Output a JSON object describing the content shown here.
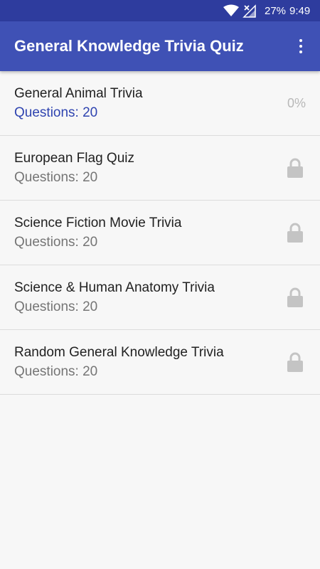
{
  "status_bar": {
    "battery": "27%",
    "time": "9:49"
  },
  "app_bar": {
    "title": "General Knowledge Trivia Quiz"
  },
  "quizzes": [
    {
      "title": "General Animal Trivia",
      "questions": "Questions: 20",
      "progress": "0%",
      "locked": false
    },
    {
      "title": "European Flag Quiz",
      "questions": "Questions: 20",
      "locked": true
    },
    {
      "title": "Science Fiction Movie Trivia",
      "questions": "Questions: 20",
      "locked": true
    },
    {
      "title": "Science & Human Anatomy Trivia",
      "questions": "Questions: 20",
      "locked": true
    },
    {
      "title": "Random General Knowledge Trivia",
      "questions": "Questions: 20",
      "locked": true
    }
  ],
  "colors": {
    "status_bar": "#2e3c9e",
    "app_bar": "#3f51b5",
    "active_count": "#2f44b0",
    "lock": "#c4c4c4"
  },
  "icons": {
    "overflow": "more-vert-icon",
    "lock": "lock-icon",
    "wifi": "wifi-icon",
    "signal": "signal-icon"
  }
}
